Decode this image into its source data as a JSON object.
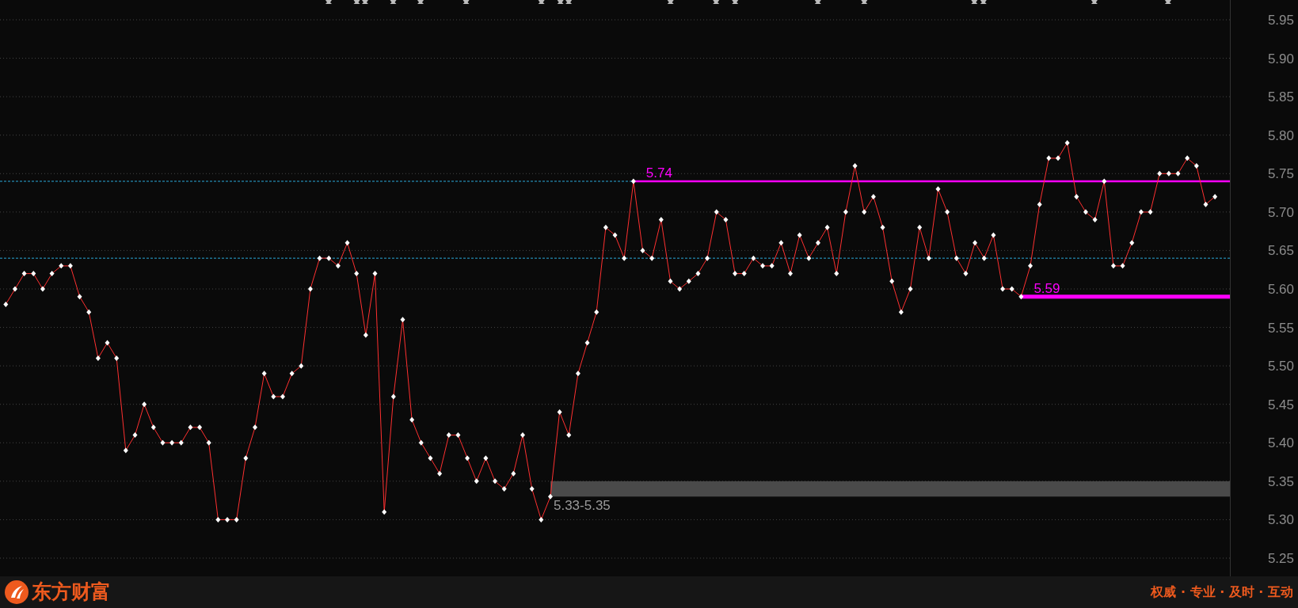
{
  "chart": {
    "chart_data": {
      "type": "line",
      "grid": true,
      "ylim": [
        5.25,
        5.95
      ],
      "yticks": [
        {
          "value": 5.25,
          "label": "5.25"
        },
        {
          "value": 5.3,
          "label": "5.30"
        },
        {
          "value": 5.35,
          "label": "5.35"
        },
        {
          "value": 5.4,
          "label": "5.40"
        },
        {
          "value": 5.45,
          "label": "5.45"
        },
        {
          "value": 5.5,
          "label": "5.50"
        },
        {
          "value": 5.55,
          "label": "5.55"
        },
        {
          "value": 5.6,
          "label": "5.60"
        },
        {
          "value": 5.65,
          "label": "5.65"
        },
        {
          "value": 5.7,
          "label": "5.70"
        },
        {
          "value": 5.75,
          "label": "5.75"
        },
        {
          "value": 5.8,
          "label": "5.80"
        },
        {
          "value": 5.85,
          "label": "5.85"
        },
        {
          "value": 5.9,
          "label": "5.90"
        },
        {
          "value": 5.95,
          "label": "5.95"
        }
      ],
      "series": [
        {
          "color": "#ff3030",
          "marker": "diamond",
          "values": [
            5.58,
            5.6,
            5.62,
            5.62,
            5.6,
            5.62,
            5.63,
            5.63,
            5.59,
            5.57,
            5.51,
            5.53,
            5.51,
            5.39,
            5.41,
            5.45,
            5.42,
            5.4,
            5.4,
            5.4,
            5.42,
            5.42,
            5.4,
            5.3,
            5.3,
            5.3,
            5.38,
            5.42,
            5.49,
            5.46,
            5.46,
            5.49,
            5.5,
            5.6,
            5.64,
            5.64,
            5.63,
            5.66,
            5.62,
            5.54,
            5.62,
            5.31,
            5.46,
            5.56,
            5.43,
            5.4,
            5.38,
            5.36,
            5.41,
            5.41,
            5.38,
            5.35,
            5.38,
            5.35,
            5.34,
            5.36,
            5.41,
            5.34,
            5.3,
            5.33,
            5.44,
            5.41,
            5.49,
            5.53,
            5.57,
            5.68,
            5.67,
            5.64,
            5.74,
            5.65,
            5.64,
            5.69,
            5.61,
            5.6,
            5.61,
            5.62,
            5.64,
            5.7,
            5.69,
            5.62,
            5.62,
            5.64,
            5.63,
            5.63,
            5.66,
            5.62,
            5.67,
            5.64,
            5.66,
            5.68,
            5.62,
            5.7,
            5.76,
            5.7,
            5.72,
            5.68,
            5.61,
            5.57,
            5.6,
            5.68,
            5.64,
            5.73,
            5.7,
            5.64,
            5.62,
            5.66,
            5.64,
            5.67,
            5.6,
            5.6,
            5.59,
            5.63,
            5.71,
            5.77,
            5.77,
            5.79,
            5.72,
            5.7,
            5.69,
            5.74,
            5.63,
            5.63,
            5.66,
            5.7,
            5.7,
            5.75,
            5.75,
            5.75,
            5.77,
            5.76,
            5.71,
            5.72
          ]
        }
      ],
      "ref_lines": [
        {
          "axis": "y",
          "value": 5.74,
          "color": "#2aa8d8"
        },
        {
          "axis": "y",
          "value": 5.64,
          "color": "#2aa8d8"
        },
        {
          "axis": "y",
          "value": 5.74,
          "label": "5.74",
          "color": "#ff00ff"
        },
        {
          "axis": "y",
          "value": 5.59,
          "label": "5.59",
          "color": "#ff00ff"
        }
      ],
      "bands": [
        {
          "axis": "y",
          "from": 5.33,
          "to": 5.35,
          "label": "5.33-5.35",
          "color": "#4a4a4a"
        }
      ]
    }
  },
  "footer": {
    "brand": "东方财富",
    "slogan": "权威 · 专业 · 及时 · 互动"
  }
}
